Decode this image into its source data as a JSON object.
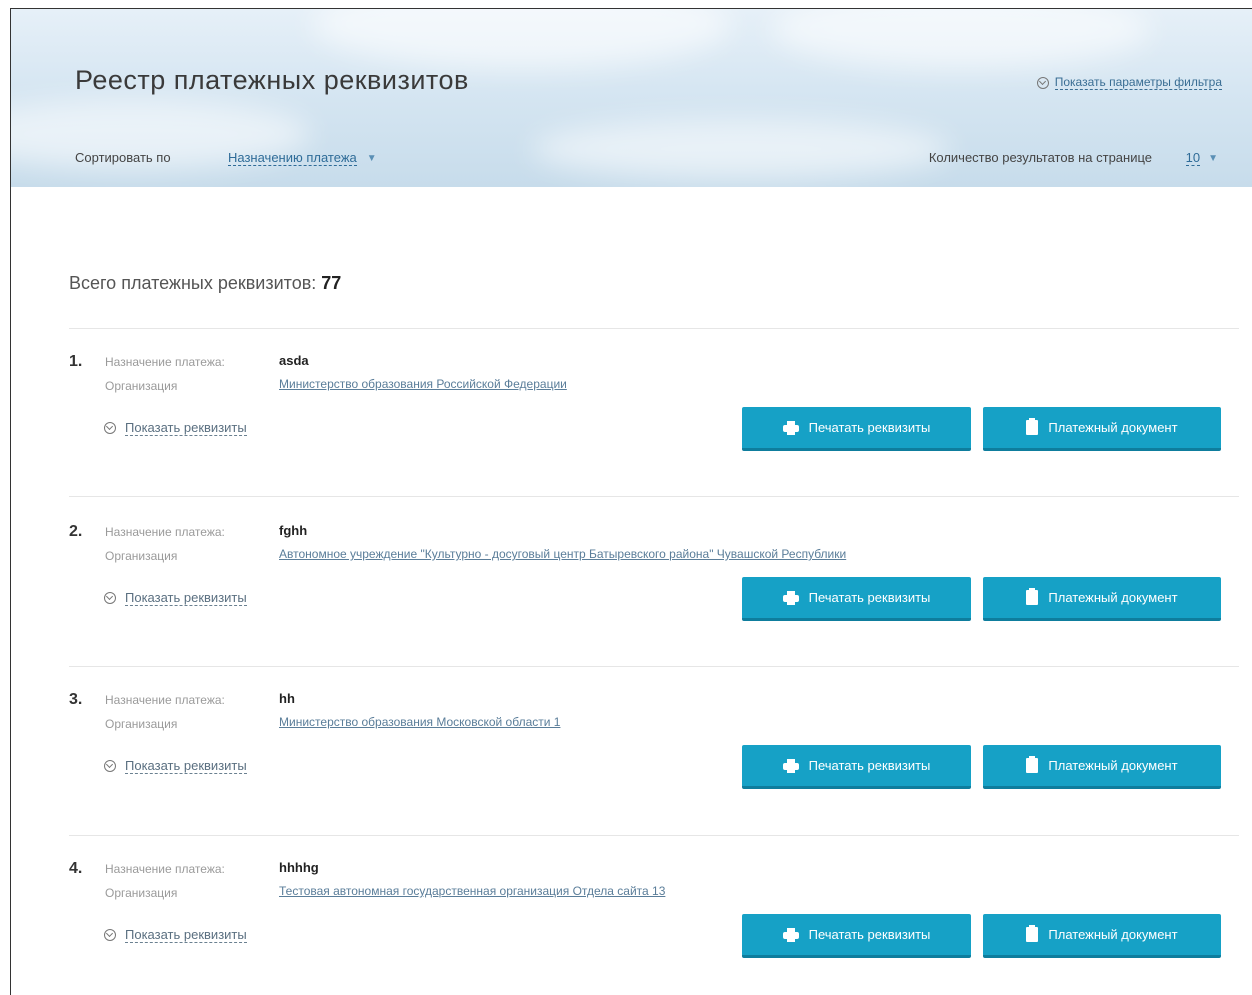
{
  "header": {
    "title": "Реестр платежных реквизитов",
    "filter_toggle": "Показать параметры фильтра",
    "sort_label": "Сортировать по",
    "sort_value": "Назначению платежа",
    "per_page_label": "Количество результатов на странице",
    "per_page_value": "10"
  },
  "summary": {
    "total_label": "Всего платежных реквизитов:",
    "total_count": "77"
  },
  "labels": {
    "purpose": "Назначение платежа:",
    "organization": "Организация",
    "show_requisites": "Показать реквизиты",
    "print_requisites": "Печатать реквизиты",
    "payment_document": "Платежный документ"
  },
  "items": [
    {
      "num": "1.",
      "purpose": "asda",
      "organization": "Министерство образования Российской Федерации"
    },
    {
      "num": "2.",
      "purpose": "fghh",
      "organization": "Автономное учреждение \"Культурно - досуговый центр Батыревского района\" Чувашской Республики"
    },
    {
      "num": "3.",
      "purpose": "hh",
      "organization": "Министерство образования Московской области 1"
    },
    {
      "num": "4.",
      "purpose": "hhhhg",
      "organization": "Тестовая автономная государственная организация Отдела сайта 13"
    }
  ],
  "colors": {
    "button": "#16a1c6",
    "link": "#2f6c98"
  }
}
